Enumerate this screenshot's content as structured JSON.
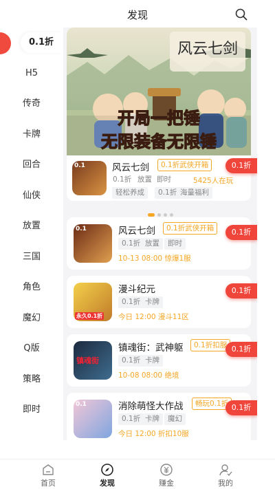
{
  "header": {
    "title": "发现"
  },
  "sidebar": {
    "items": [
      {
        "label": "0.1折"
      },
      {
        "label": "H5"
      },
      {
        "label": "传奇"
      },
      {
        "label": "卡牌"
      },
      {
        "label": "回合"
      },
      {
        "label": "仙侠"
      },
      {
        "label": "放置"
      },
      {
        "label": "三国"
      },
      {
        "label": "角色"
      },
      {
        "label": "魔幻"
      },
      {
        "label": "Q版"
      },
      {
        "label": "策略"
      },
      {
        "label": "即时"
      }
    ]
  },
  "banner": {
    "art_title": "风云七剑",
    "slogan_line1": "开局一把锤",
    "slogan_line2": "无限装备无限锤",
    "game": {
      "name": "风云七剑",
      "promo": "0.1折武侠开箱",
      "tags": [
        "0.1折",
        "放置",
        "即时"
      ],
      "online": "5425人在玩",
      "tags2": [
        "轻松养成",
        "0.1折",
        "海量福利"
      ],
      "discount": "0.1折",
      "icon_badge": "0.1"
    }
  },
  "games": [
    {
      "name": "风云七剑",
      "promo": "0.1折武侠开箱",
      "tags": [
        "0.1折",
        "放置",
        "即时"
      ],
      "info": "10-13 08:00 惊爆1服",
      "discount": "0.1折",
      "icon_badge": "0.1"
    },
    {
      "name": "漫斗纪元",
      "promo": "",
      "tags": [
        "0.1折",
        "卡牌"
      ],
      "info": "今日 12:00 漫斗11区",
      "discount": "0.1折",
      "icon_badge": "永久0.1折"
    },
    {
      "name": "镇魂街：武神躯",
      "promo": "0.1折扣服",
      "tags": [
        "0.1折",
        "卡牌"
      ],
      "info": "10-08 08:00 绝境",
      "discount": "0.1折",
      "icon_badge": "镇魂街"
    },
    {
      "name": "消除萌怪大作战",
      "promo": "畅玩0.1折",
      "tags": [
        "0.1折",
        "卡牌",
        "魔幻"
      ],
      "info": "今日 12:00 折扣10服",
      "discount": "0.1折",
      "icon_badge": "0.1"
    }
  ],
  "tabbar": {
    "items": [
      {
        "label": "首页",
        "icon": "home-icon"
      },
      {
        "label": "发现",
        "icon": "compass-icon"
      },
      {
        "label": "赚金",
        "icon": "coin-icon"
      },
      {
        "label": "我的",
        "icon": "user-icon"
      }
    ]
  },
  "colors": {
    "accent": "#f0453a",
    "promo": "#f5a623",
    "panel": "#f4f4f6"
  }
}
